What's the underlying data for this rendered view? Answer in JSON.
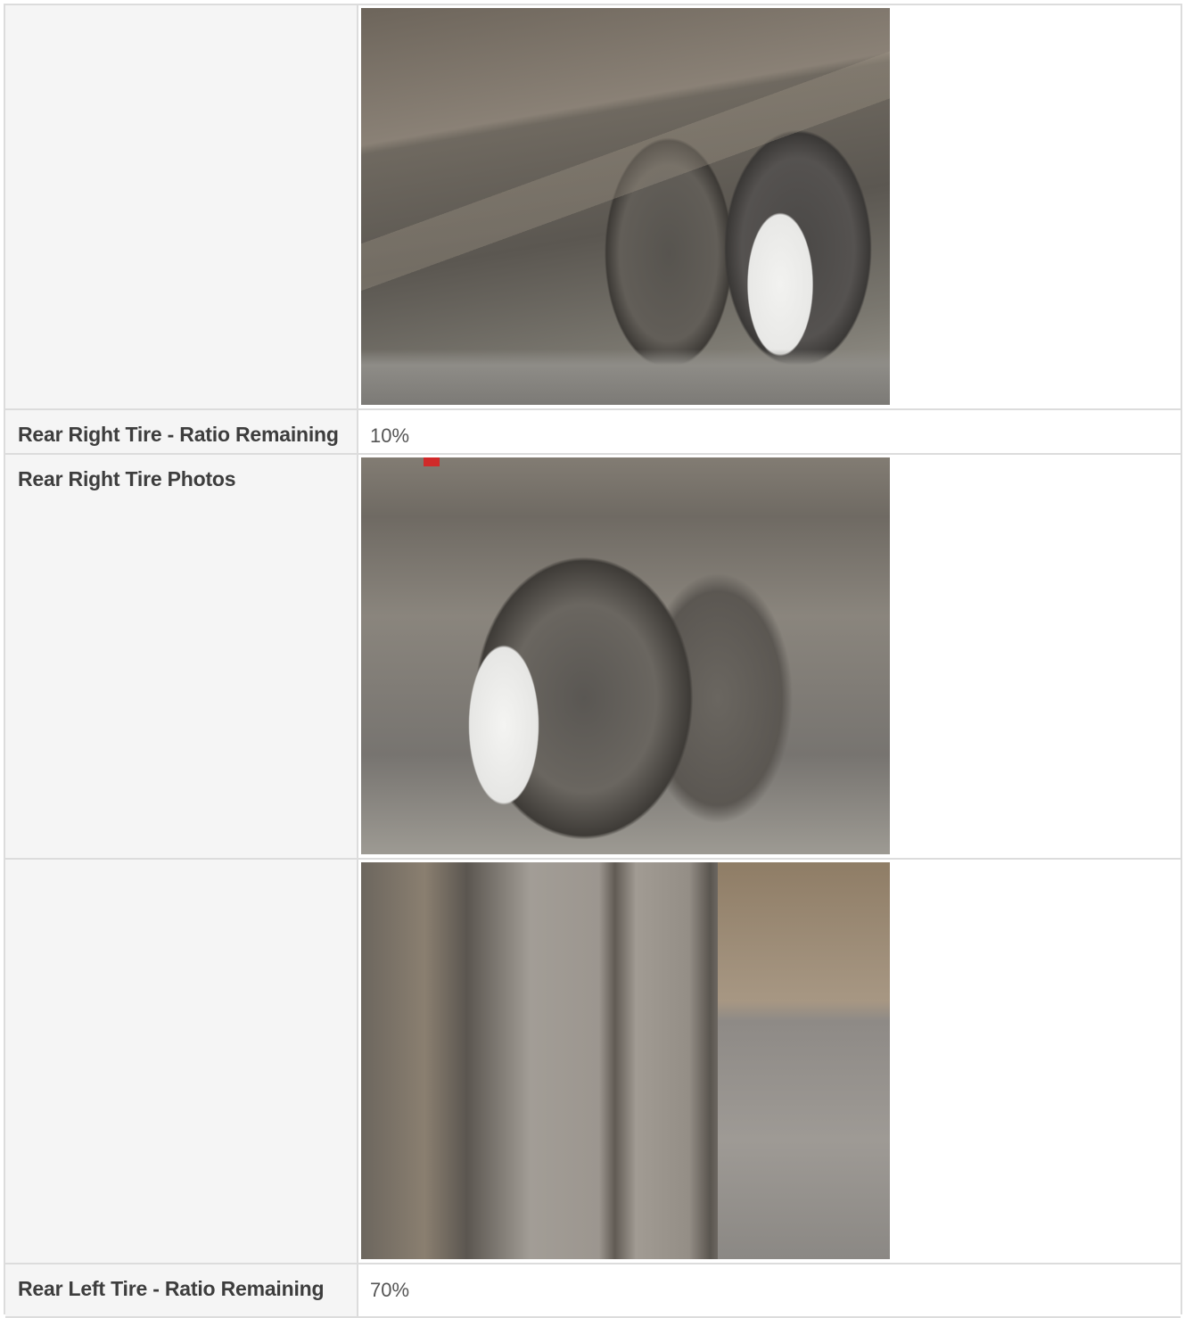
{
  "rows": [
    {
      "label": "",
      "photo": "dual-tire-photo"
    },
    {
      "label": "Rear Right Tire - Ratio Remaining",
      "value": "10%"
    },
    {
      "label": "Rear Right Tire Photos",
      "photo": "rim-tire-photo"
    },
    {
      "label": "",
      "photo": "tread-closeup-photo"
    },
    {
      "label": "Rear Left Tire - Ratio Remaining",
      "value": "70%"
    }
  ]
}
